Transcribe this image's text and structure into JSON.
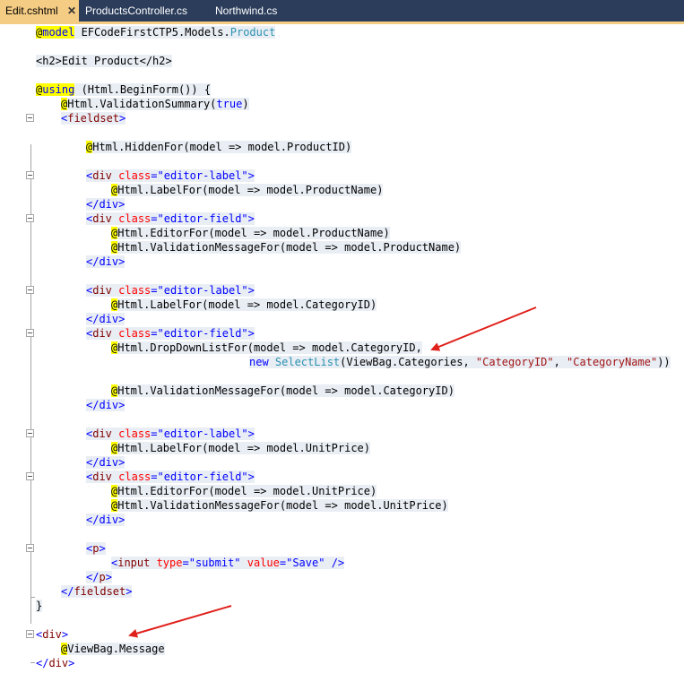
{
  "tabs": [
    {
      "label": "Edit.cshtml",
      "active": true,
      "close": "✕"
    },
    {
      "label": "ProductsController.cs",
      "active": false
    },
    {
      "label": "Northwind.cs",
      "active": false
    }
  ],
  "code": {
    "l1": {
      "at": "@",
      "kw": "model",
      "t1": " EFCodeFirstCTP5.Models.",
      "type": "Product"
    },
    "l3": {
      "t1": "<h2>",
      "t2": "Edit Product",
      "t3": "</h2>"
    },
    "l5": {
      "at": "@",
      "kw": "using",
      "t1": " (Html.BeginForm()) {"
    },
    "l6": {
      "at": "@",
      "t1": "Html.ValidationSummary(",
      "kw": "true",
      "t2": ")"
    },
    "l7": {
      "t1": "<",
      "tag": "fieldset",
      "t2": ">"
    },
    "l9": {
      "at": "@",
      "t1": "Html.HiddenFor(model => model.ProductID)"
    },
    "div_open": "<",
    "div_tag": "div",
    "class_attr": " class",
    "eq": "=",
    "editor_label": "\"editor-label\"",
    "editor_field": "\"editor-field\"",
    "gt": ">",
    "div_close": "</div>",
    "l12": {
      "at": "@",
      "t1": "Html.LabelFor(model => model.ProductName)"
    },
    "l15": {
      "at": "@",
      "t1": "Html.EditorFor(model => model.ProductName)"
    },
    "l16": {
      "at": "@",
      "t1": "Html.ValidationMessageFor(model => model.ProductName)"
    },
    "l20": {
      "at": "@",
      "t1": "Html.LabelFor(model => model.CategoryID)"
    },
    "l23": {
      "at": "@",
      "t1": "Html.DropDownListFor(model => model.CategoryID,"
    },
    "l24": {
      "kw": "new",
      "type": " SelectList",
      "t1": "(ViewBag.Categories, ",
      "s1": "\"CategoryID\"",
      "t2": ", ",
      "s2": "\"CategoryName\"",
      "t3": "))"
    },
    "l26": {
      "at": "@",
      "t1": "Html.ValidationMessageFor(model => model.CategoryID)"
    },
    "l30": {
      "at": "@",
      "t1": "Html.LabelFor(model => model.UnitPrice)"
    },
    "l33": {
      "at": "@",
      "t1": "Html.EditorFor(model => model.UnitPrice)"
    },
    "l34": {
      "at": "@",
      "t1": "Html.ValidationMessageFor(model => model.UnitPrice)"
    },
    "l37": {
      "t1": "<",
      "tag": "p",
      "t2": ">"
    },
    "l38": {
      "t1": "<",
      "tag": "input",
      "a1": " type",
      "e1": "=",
      "s1": "\"submit\"",
      "a2": " value",
      "e2": "=",
      "s2": "\"Save\"",
      "t2": " />"
    },
    "l39": {
      "t1": "</",
      "tag": "p",
      "t2": ">"
    },
    "l40": {
      "t1": "</",
      "tag": "fieldset",
      "t2": ">"
    },
    "l41": {
      "t1": "}"
    },
    "l43": {
      "t1": "<",
      "tag": "div",
      "t2": ">"
    },
    "l44": {
      "at": "@",
      "t1": "ViewBag.Message"
    },
    "l45": {
      "t1": "</",
      "tag": "div",
      "t2": ">"
    }
  },
  "colors": {
    "tab_bg": "#2b3d5b",
    "tab_active": "#f5cc84",
    "arrow": "#e0201b"
  },
  "icons": [
    "close-icon",
    "collapse-icon",
    "annotation-arrow"
  ]
}
